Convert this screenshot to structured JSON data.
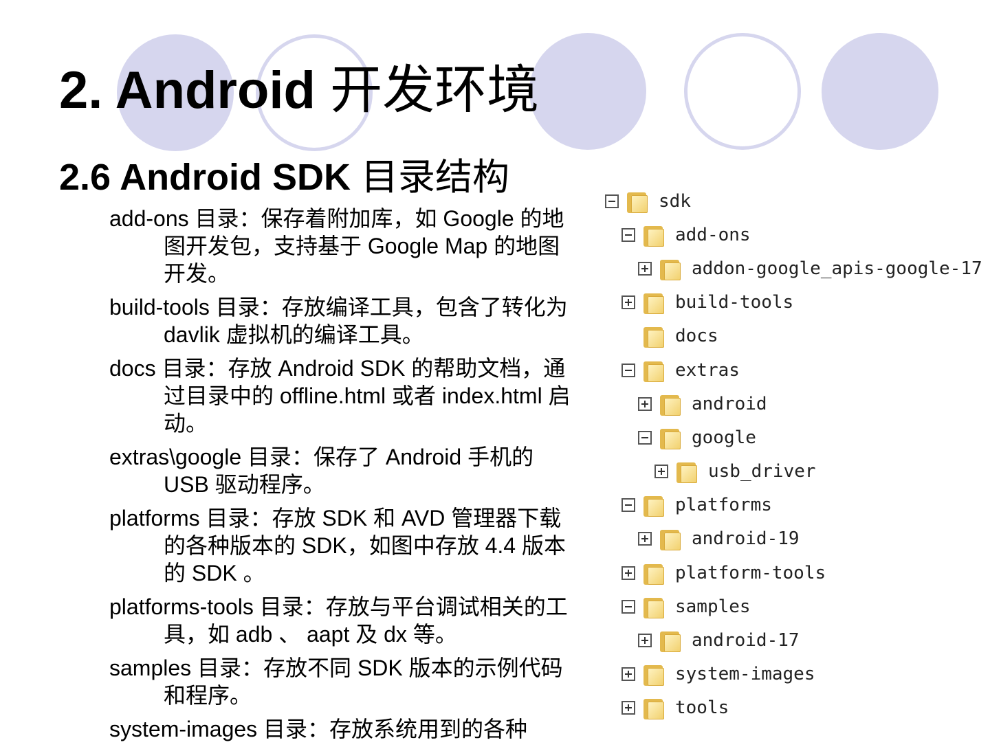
{
  "slide": {
    "title_prefix": "2. Android",
    "title_cjk": "开发环境",
    "section_prefix": "2.6 Android SDK",
    "section_cjk": "目录结构"
  },
  "descriptions": [
    "add-ons 目录：保存着附加库，如 Google 的地图开发包，支持基于 Google Map 的地图开发。",
    "build-tools 目录：存放编译工具，包含了转化为 davlik 虚拟机的编译工具。",
    "docs 目录：存放 Android SDK 的帮助文档，通过目录中的 offline.html 或者 index.html 启动。",
    "extras\\google 目录：保存了 Android 手机的 USB 驱动程序。",
    "platforms 目录：存放 SDK 和 AVD 管理器下载的各种版本的 SDK，如图中存放 4.4 版本的 SDK 。",
    "platforms-tools 目录：存放与平台调试相关的工具，如 adb 、 aapt 及 dx 等。",
    "samples 目录：存放不同 SDK 版本的示例代码和程序。",
    "system-images 目录：存放系统用到的各种"
  ],
  "tree": [
    {
      "label": "sdk",
      "level": 0,
      "toggle": "minus"
    },
    {
      "label": "add-ons",
      "level": 1,
      "toggle": "minus"
    },
    {
      "label": "addon-google_apis-google-17",
      "level": 2,
      "toggle": "plus"
    },
    {
      "label": "build-tools",
      "level": 1,
      "toggle": "plus"
    },
    {
      "label": "docs",
      "level": 1,
      "toggle": "none"
    },
    {
      "label": "extras",
      "level": 1,
      "toggle": "minus"
    },
    {
      "label": "android",
      "level": 2,
      "toggle": "plus"
    },
    {
      "label": "google",
      "level": 2,
      "toggle": "minus"
    },
    {
      "label": "usb_driver",
      "level": 3,
      "toggle": "plus"
    },
    {
      "label": "platforms",
      "level": 1,
      "toggle": "minus"
    },
    {
      "label": "android-19",
      "level": 2,
      "toggle": "plus"
    },
    {
      "label": "platform-tools",
      "level": 1,
      "toggle": "plus"
    },
    {
      "label": "samples",
      "level": 1,
      "toggle": "minus"
    },
    {
      "label": "android-17",
      "level": 2,
      "toggle": "plus"
    },
    {
      "label": "system-images",
      "level": 1,
      "toggle": "plus"
    },
    {
      "label": "tools",
      "level": 1,
      "toggle": "plus"
    }
  ]
}
